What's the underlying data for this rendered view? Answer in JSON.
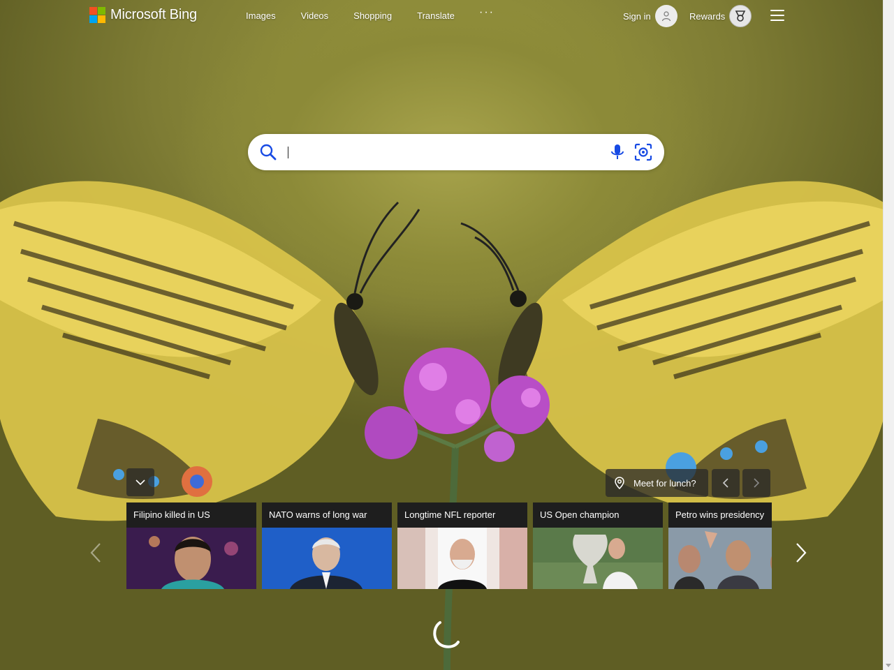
{
  "brand": {
    "name": "Microsoft Bing",
    "colors": {
      "red": "#f25022",
      "green": "#7fba00",
      "blue": "#00a4ef",
      "yellow": "#ffb900"
    }
  },
  "nav": {
    "items": [
      {
        "label": "Images"
      },
      {
        "label": "Videos"
      },
      {
        "label": "Shopping"
      },
      {
        "label": "Translate"
      }
    ],
    "more_label": "···"
  },
  "account": {
    "signin_label": "Sign in",
    "rewards_label": "Rewards"
  },
  "search": {
    "value": "",
    "placeholder": "",
    "icons": [
      "search-icon",
      "microphone-icon",
      "visual-search-icon"
    ],
    "accent": "#174ae4"
  },
  "image_controls": {
    "lunch_label": "Meet for lunch?"
  },
  "news": [
    {
      "title": "Filipino killed in US"
    },
    {
      "title": "NATO warns of long war"
    },
    {
      "title": "Longtime NFL reporter"
    },
    {
      "title": "US Open champion"
    },
    {
      "title": "Petro wins presidency"
    }
  ]
}
